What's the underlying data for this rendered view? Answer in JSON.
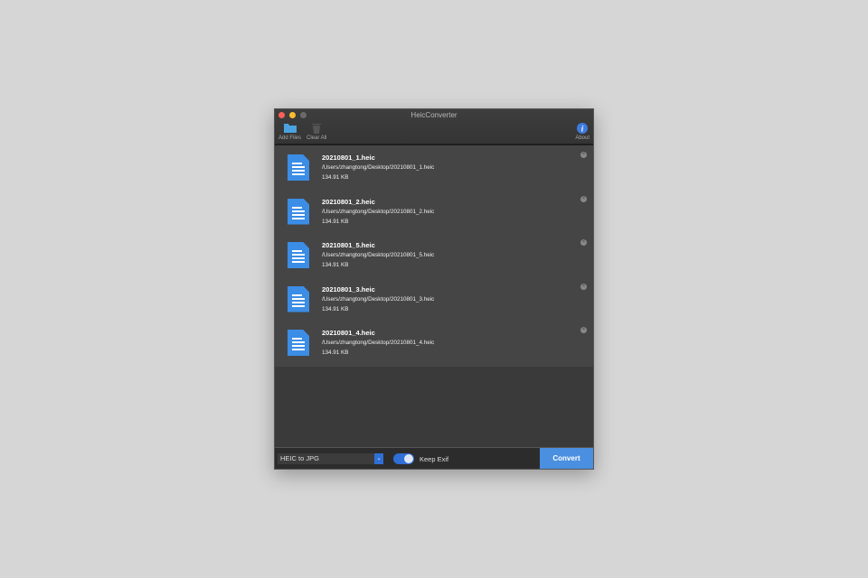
{
  "window": {
    "title": "HeicConverter"
  },
  "toolbar": {
    "add_files": "Add Files",
    "clear_all": "Clear All",
    "about": "About"
  },
  "files": [
    {
      "name": "20210801_1.heic",
      "path": "/Users/zhangtong/Desktop/20210801_1.heic",
      "size": "134.91 KB"
    },
    {
      "name": "20210801_2.heic",
      "path": "/Users/zhangtong/Desktop/20210801_2.heic",
      "size": "134.91 KB"
    },
    {
      "name": "20210801_5.heic",
      "path": "/Users/zhangtong/Desktop/20210801_5.heic",
      "size": "134.91 KB"
    },
    {
      "name": "20210801_3.heic",
      "path": "/Users/zhangtong/Desktop/20210801_3.heic",
      "size": "134.91 KB"
    },
    {
      "name": "20210801_4.heic",
      "path": "/Users/zhangtong/Desktop/20210801_4.heic",
      "size": "134.91 KB"
    }
  ],
  "footer": {
    "format": "HEIC to JPG",
    "keep_exif_label": "Keep Exif",
    "keep_exif": true,
    "convert": "Convert"
  },
  "colors": {
    "accent": "#4a8fe0",
    "toggle": "#2f6fd6"
  }
}
